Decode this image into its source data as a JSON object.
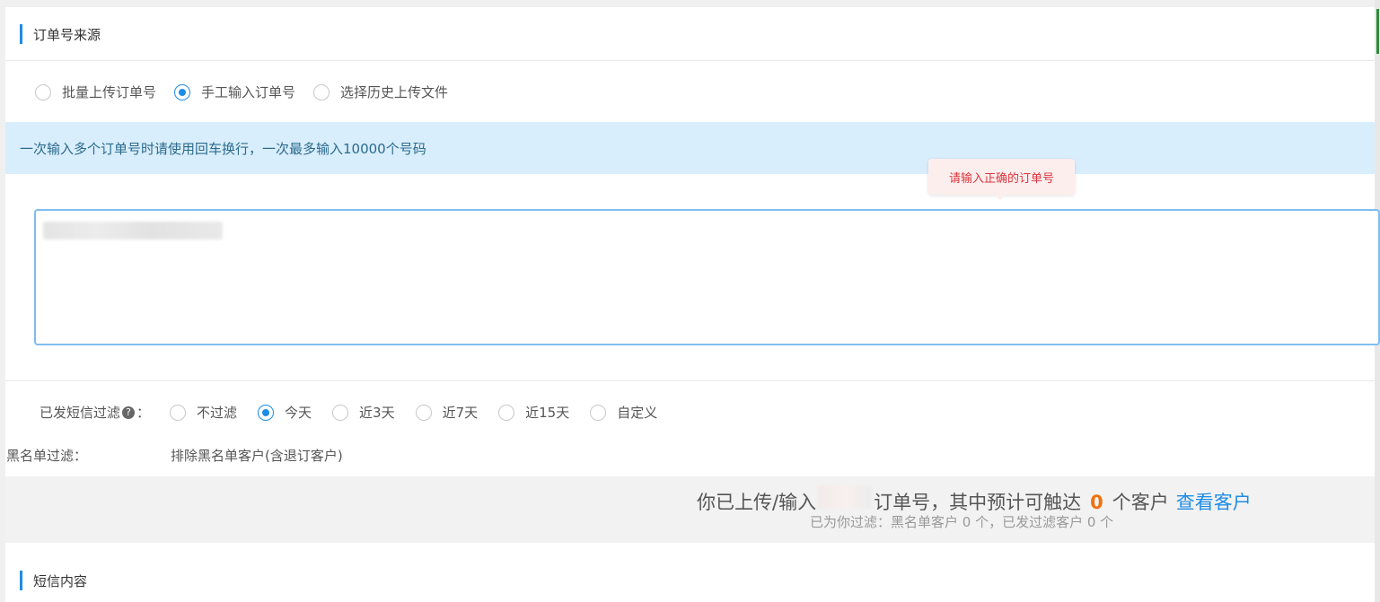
{
  "order_source": {
    "title": "订单号来源",
    "options": [
      {
        "label": "批量上传订单号",
        "checked": false
      },
      {
        "label": "手工输入订单号",
        "checked": true
      },
      {
        "label": "选择历史上传文件",
        "checked": false
      }
    ]
  },
  "notice": {
    "text": "一次输入多个订单号时请使用回车换行，一次最多输入10000个号码"
  },
  "validation_tooltip": {
    "text": "请输入正确的订单号"
  },
  "sms_filter": {
    "label": "已发短信过滤",
    "help_icon": "question-circle-icon",
    "colon": "：",
    "options": [
      {
        "label": "不过滤",
        "checked": false
      },
      {
        "label": "今天",
        "checked": true
      },
      {
        "label": "近3天",
        "checked": false
      },
      {
        "label": "近7天",
        "checked": false
      },
      {
        "label": "近15天",
        "checked": false
      },
      {
        "label": "自定义",
        "checked": false
      }
    ]
  },
  "blacklist_filter": {
    "label": "黑名单过滤：",
    "value": "排除黑名单客户(含退订客户)"
  },
  "summary": {
    "prefix": "你已上传/输入",
    "middle": "订单号，其中预计可触达",
    "reach_count": "0",
    "suffix": "个客户",
    "link": "查看客户",
    "detail": "已为你过滤：黑名单客户  0  个，已发过滤客户  0  个"
  },
  "sms_content": {
    "title": "短信内容"
  },
  "colors": {
    "accent": "#1e8ce6",
    "notice_bg": "#d9eefc",
    "error": "#d9363e",
    "count": "#f07010"
  }
}
